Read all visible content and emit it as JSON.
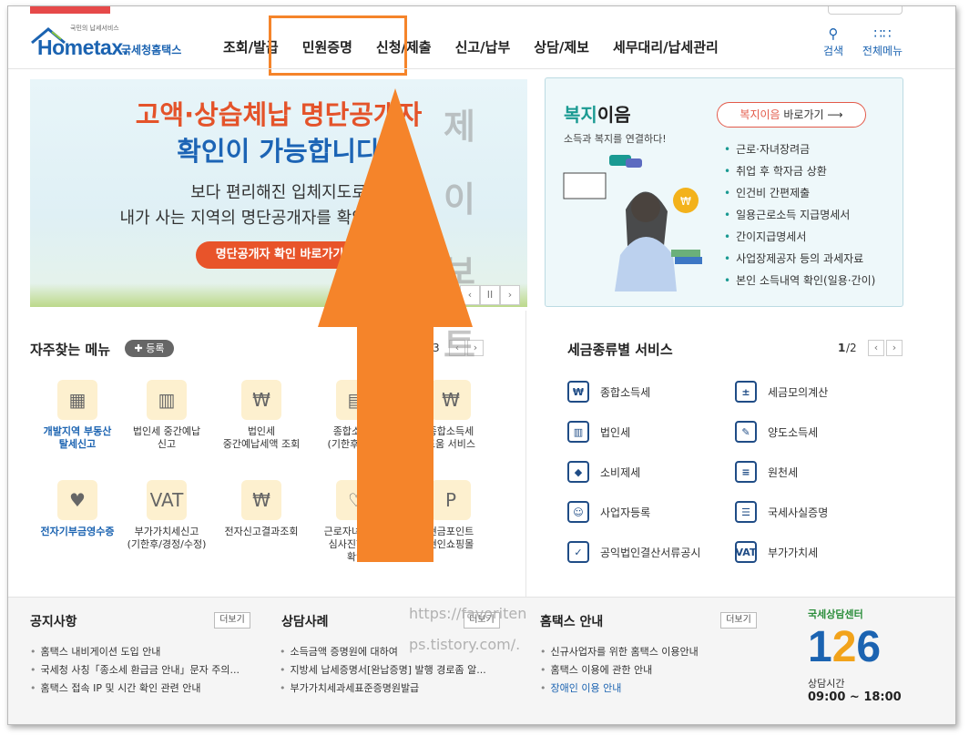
{
  "header": {
    "logo_small": "국민의 납세서비스",
    "logo_main": "Hometax.",
    "logo_kr": "국세청홈택스",
    "gnb": [
      "조회/발급",
      "민원증명",
      "신청/제출",
      "신고/납부",
      "상담/제보",
      "세무대리/납세관리"
    ],
    "search_label": "검색",
    "menu_label": "전체메뉴",
    "search_icon": "search-icon",
    "menu_icon": "grid-icon"
  },
  "banner": {
    "line1": "고액·상습체납 명단공개자",
    "line2": "확인이 가능합니다",
    "line3": "보다 편리해진 입체지도로",
    "line4": "내가 사는 지역의 명단공개자를 확인해 보세요.",
    "button": "명단공개자 확인 바로가기",
    "prev": "‹",
    "pause": "II",
    "next": "›"
  },
  "welfare": {
    "title_accent": "복지",
    "title_rest": "이음",
    "subtitle": "소득과 복지를 연결하다!",
    "go_accent": "복지이음",
    "go_rest": " 바로가기",
    "items": [
      "근로·자녀장려금",
      "취업 후 학자금 상환",
      "인건비 간편제출",
      "일용근로소득 지급명세서",
      "간이지급명세서",
      "사업장제공자 등의 과세자료",
      "본인 소득내역 확인(일용·간이)"
    ]
  },
  "favorites": {
    "title": "자주찾는 메뉴",
    "add_label": "등록",
    "page": "/3",
    "items": [
      {
        "label": "개발지역 부동산\n탈세신고",
        "icon": "▦",
        "highlight": true
      },
      {
        "label": "법인세 중간예납\n신고",
        "icon": "▥",
        "highlight": false
      },
      {
        "label": "법인세\n중간예납세액 조회",
        "icon": "₩",
        "highlight": false
      },
      {
        "label": "종합소득세\n(기한후/경정)",
        "icon": "▤",
        "highlight": false
      },
      {
        "label": "종합소득세\n도움 서비스",
        "icon": "₩",
        "highlight": false
      },
      {
        "label": "전자기부금영수증",
        "icon": "♥",
        "highlight": true
      },
      {
        "label": "부가가치세신고\n(기한후/경정/수정)",
        "icon": "VAT",
        "highlight": false
      },
      {
        "label": "전자신고결과조회",
        "icon": "₩",
        "highlight": false
      },
      {
        "label": "근로자녀장려금\n심사진행상황\n확인",
        "icon": "♡",
        "highlight": false
      },
      {
        "label": "현금포인트\n현인쇼핑몰",
        "icon": "P",
        "highlight": false
      }
    ]
  },
  "taxservices": {
    "title": "세금종류별 서비스",
    "page_current": "1",
    "page_total": "/2",
    "items": [
      {
        "label": "종합소득세",
        "icon": "₩"
      },
      {
        "label": "세금모의계산",
        "icon": "±"
      },
      {
        "label": "법인세",
        "icon": "▥"
      },
      {
        "label": "양도소득세",
        "icon": "✎"
      },
      {
        "label": "소비제세",
        "icon": "◆"
      },
      {
        "label": "원천세",
        "icon": "≡"
      },
      {
        "label": "사업자등록",
        "icon": "☺"
      },
      {
        "label": "국세사실증명",
        "icon": "☰"
      },
      {
        "label": "공익법인결산서류공시",
        "icon": "✓"
      },
      {
        "label": "부가가치세",
        "icon": "VAT"
      }
    ]
  },
  "bottom": {
    "notice": {
      "title": "공지사항",
      "more": "더보기",
      "items": [
        "홈택스 내비게이션 도입 안내",
        "국세청 사칭「종소세 환급금 안내」문자 주의...",
        "홈택스 접속 IP 및 시간 확인 관련 안내"
      ]
    },
    "counsel": {
      "title": "상담사례",
      "more": "더보기",
      "items": [
        "소득금액 증명원에 대하여",
        "지방세 납세증명서[완납증명] 발행 경로좀 알...",
        "부가가치세과세표준증명원발급"
      ]
    },
    "guide": {
      "title": "홈택스 안내",
      "more": "더보기",
      "items": [
        "신규사업자를 위한 홈택스 이용안내",
        "홈택스 이용에 관한 안내",
        "장애인 이용 안내"
      ]
    },
    "center": {
      "title": "국세상담센터",
      "digit1": "1",
      "digit2": "2",
      "digit3": "6",
      "hours_label": "상담시간",
      "hours": "09:00 ~ 18:00"
    }
  },
  "overlay": {
    "watermark_line1": "https://favoriten",
    "watermark_line2": "ps.tistory.com/.",
    "ghost_chars": [
      "제",
      "이",
      "보",
      "트"
    ],
    "arrow_color": "#f5842a"
  }
}
